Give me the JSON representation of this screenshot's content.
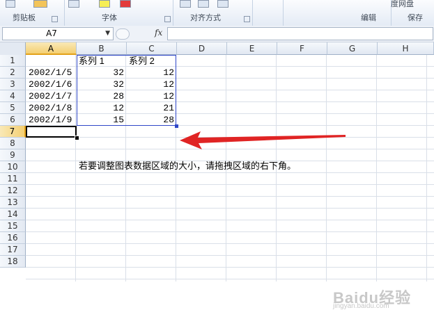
{
  "ribbon": {
    "groups": [
      {
        "label": "剪贴板"
      },
      {
        "label": "字体"
      },
      {
        "label": "对齐方式"
      },
      {
        "label": "编辑"
      },
      {
        "label": "保存"
      }
    ],
    "top_right_partial": "度网盘"
  },
  "formula_bar": {
    "name_box": "A7",
    "fx_label": "fx",
    "formula": ""
  },
  "sheet": {
    "columns": [
      "A",
      "B",
      "C",
      "D",
      "E",
      "F",
      "G",
      "H"
    ],
    "selected_column": "A",
    "rows": [
      "1",
      "2",
      "3",
      "4",
      "5",
      "6",
      "7",
      "8",
      "9",
      "10",
      "11",
      "12",
      "13",
      "14",
      "15",
      "16",
      "17",
      "18"
    ],
    "selected_row": "7",
    "header_row": {
      "b": "系列 1",
      "c": "系列 2"
    },
    "data": [
      {
        "a": "2002/1/5",
        "b": "32",
        "c": "12"
      },
      {
        "a": "2002/1/6",
        "b": "32",
        "c": "12"
      },
      {
        "a": "2002/1/7",
        "b": "28",
        "c": "12"
      },
      {
        "a": "2002/1/8",
        "b": "12",
        "c": "21"
      },
      {
        "a": "2002/1/9",
        "b": "15",
        "c": "28"
      }
    ],
    "note": "若要调整图表数据区域的大小，请拖拽区域的右下角。"
  },
  "watermark": {
    "text": "Baidu经验",
    "sub": "jingyan.baidu.com"
  },
  "colors": {
    "range_border": "#2f47c8",
    "arrow": "#e02424",
    "selected_header": "#f4cf72"
  }
}
